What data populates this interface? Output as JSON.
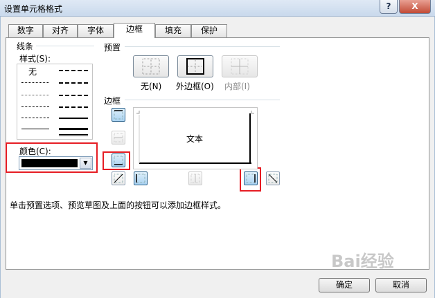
{
  "window": {
    "title": "设置单元格格式",
    "help_label": "?",
    "close_label": "X"
  },
  "tabs": [
    {
      "label": "数字",
      "active": false
    },
    {
      "label": "对齐",
      "active": false
    },
    {
      "label": "字体",
      "active": false
    },
    {
      "label": "边框",
      "active": true
    },
    {
      "label": "填充",
      "active": false
    },
    {
      "label": "保护",
      "active": false
    }
  ],
  "line_group": {
    "title": "线条",
    "style_label": "样式(S):",
    "none_label": "无",
    "color_label": "颜色(C):",
    "color_value": "#000000",
    "dropdown_icon": "▼"
  },
  "presets": {
    "title": "预置",
    "items": [
      {
        "label": "无(N)",
        "icon": "preset-none"
      },
      {
        "label": "外边框(O)",
        "icon": "preset-outline"
      },
      {
        "label": "内部(I)",
        "icon": "preset-inside",
        "disabled": true
      }
    ]
  },
  "border": {
    "title": "边框",
    "preview_text": "文本"
  },
  "hint": "单击预置选项、预览草图及上面的按钮可以添加边框样式。",
  "buttons": {
    "ok": "确定",
    "cancel": "取消"
  },
  "watermark": "Bai经验",
  "colors": {
    "highlight": "#e61c23",
    "pressed": "#a9d2f1"
  }
}
